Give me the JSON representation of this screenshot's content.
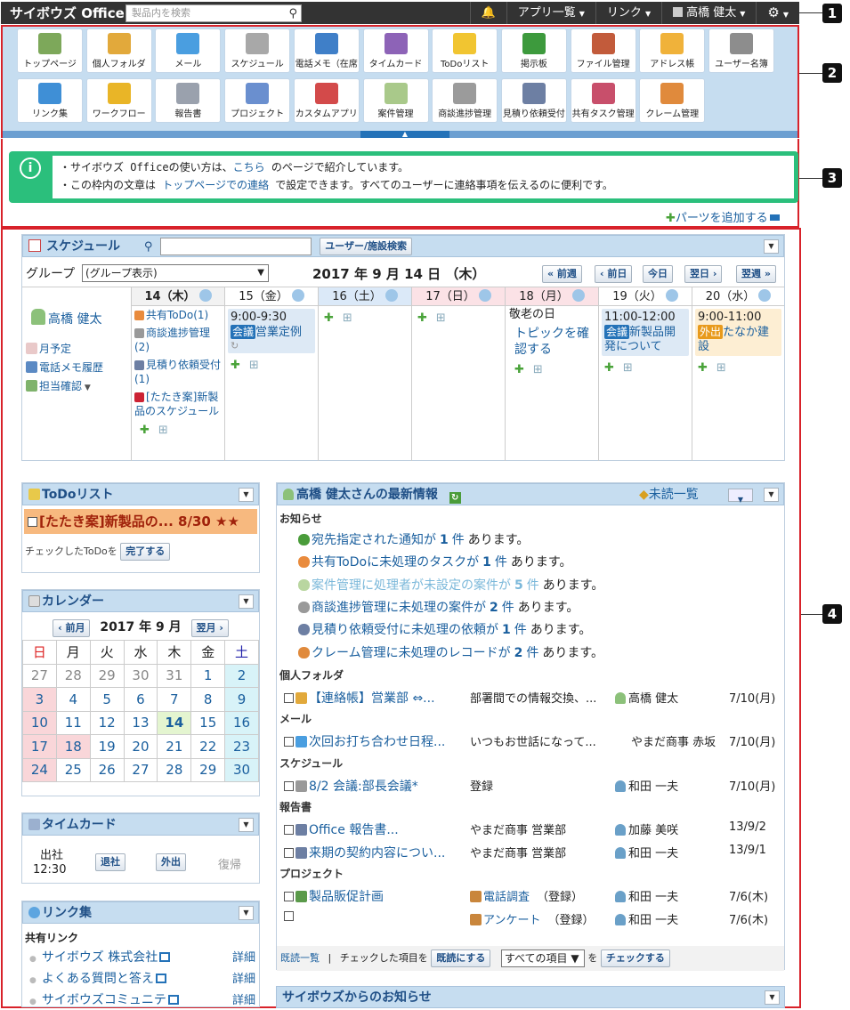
{
  "topbar": {
    "logo": "サイボウズ Office",
    "search_placeholder": "製品内を検索",
    "bell": "🔔",
    "apps_menu": "アプリ一覧",
    "link_menu": "リンク",
    "user_name": "高橋 健太",
    "gear": "⚙"
  },
  "markers": [
    "1",
    "2",
    "3",
    "4"
  ],
  "apps": [
    {
      "label": "トップページ",
      "color": "#7da85a"
    },
    {
      "label": "個人フォルダ",
      "color": "#e2a93b"
    },
    {
      "label": "メール",
      "color": "#4a9ee0"
    },
    {
      "label": "スケジュール",
      "color": "#a8a8a8"
    },
    {
      "label": "電話メモ（在席",
      "color": "#3f7fc8"
    },
    {
      "label": "タイムカード",
      "color": "#8d63b7"
    },
    {
      "label": "ToDoリスト",
      "color": "#f1c531"
    },
    {
      "label": "掲示板",
      "color": "#3d9a3d"
    },
    {
      "label": "ファイル管理",
      "color": "#c25b3b"
    },
    {
      "label": "アドレス帳",
      "color": "#f0b23a"
    },
    {
      "label": "ユーザー名簿",
      "color": "#8d8d8d"
    },
    {
      "label": "リンク集",
      "color": "#3f8fd6"
    },
    {
      "label": "ワークフロー",
      "color": "#e9b527"
    },
    {
      "label": "報告書",
      "color": "#9aa1ad"
    },
    {
      "label": "プロジェクト",
      "color": "#6a8fcf"
    },
    {
      "label": "カスタムアプリ",
      "color": "#d34a4a"
    },
    {
      "label": "案件管理",
      "color": "#a9c98a"
    },
    {
      "label": "商談進捗管理",
      "color": "#9b9b9b"
    },
    {
      "label": "見積り依頼受付",
      "color": "#6d7fa3"
    },
    {
      "label": "共有タスク管理",
      "color": "#c84f6b"
    },
    {
      "label": "クレーム管理",
      "color": "#e08a3c"
    }
  ],
  "info": {
    "line1a": "・サイボウズ Officeの使い方は、",
    "line1link": "こちら",
    "line1b": " のページで紹介しています。",
    "line2a": "・この枠内の文章は ",
    "line2link": "トップページでの連絡",
    "line2b": " で設定できます。すべてのユーザーに連絡事項を伝えるのに便利です。",
    "add_parts": "パーツを追加する"
  },
  "schedule": {
    "title": "スケジュール",
    "search_button": "ユーザー/施設検索",
    "group_label": "グループ",
    "group_select": "(グループ表示)",
    "date_title": "2017 年 9 月 14 日 （木）",
    "nav": [
      "« 前週",
      "‹ 前日",
      "今日",
      "翌日 ›",
      "翌週 »"
    ],
    "days": [
      {
        "label": "14（木）",
        "bg": "#f2f2f2"
      },
      {
        "label": "15（金）",
        "bg": "#ffffff"
      },
      {
        "label": "16（土）",
        "bg": "#dbe9f8"
      },
      {
        "label": "17（日）",
        "bg": "#fbe2e6"
      },
      {
        "label": "18（月）",
        "bg": "#fbe2e6"
      },
      {
        "label": "19（火）",
        "bg": "#ffffff"
      },
      {
        "label": "20（水）",
        "bg": "#ffffff"
      }
    ],
    "user": "高橋 健太",
    "user_links": [
      "月予定",
      "電話メモ履歴",
      "担当確認"
    ],
    "day14": [
      "共有ToDo(1)",
      "商談進捗管理(2)",
      "見積り依頼受付(1)",
      "[たたき案]新製品のスケジュール"
    ],
    "day15": {
      "time": "9:00-9:30",
      "badge": "会議",
      "title": "営業定例"
    },
    "day18": {
      "holiday": "敬老の日",
      "item": "トピックを確認する"
    },
    "day19": {
      "time": "11:00-12:00",
      "badge": "会議",
      "title": "新製品開発について"
    },
    "day20": {
      "time": "9:00-11:00",
      "badge": "外出",
      "title": "たなか建設"
    }
  },
  "todo": {
    "title": "ToDoリスト",
    "item": "[たたき案]新製品の... 8/30 ★★",
    "footer_label": "チェックしたToDoを",
    "complete_button": "完了する"
  },
  "calendar": {
    "title": "カレンダー",
    "prev": "‹ 前月",
    "month": "2017 年 9 月",
    "next": "翌月 ›",
    "weekdays": [
      "日",
      "月",
      "火",
      "水",
      "木",
      "金",
      "土"
    ],
    "weeks": [
      [
        "27",
        "28",
        "29",
        "30",
        "31",
        "1",
        "2"
      ],
      [
        "3",
        "4",
        "5",
        "6",
        "7",
        "8",
        "9"
      ],
      [
        "10",
        "11",
        "12",
        "13",
        "14",
        "15",
        "16"
      ],
      [
        "17",
        "18",
        "19",
        "20",
        "21",
        "22",
        "23"
      ],
      [
        "24",
        "25",
        "26",
        "27",
        "28",
        "29",
        "30"
      ]
    ]
  },
  "timecard": {
    "title": "タイムカード",
    "in_label": "出社",
    "in_time": "12:30",
    "leave": "退社",
    "out": "外出",
    "return": "復帰"
  },
  "links": {
    "title": "リンク集",
    "section": "共有リンク",
    "items": [
      "サイボウズ 株式会社",
      "よくある質問と答え",
      "サイボウズコミュニテ"
    ],
    "detail": "詳細"
  },
  "news": {
    "title": "高橋 健太さんの最新情報",
    "unread": "未読一覧",
    "notice": "お知らせ",
    "notices": [
      {
        "text": "宛先指定された通知が",
        "count": "1",
        "unit": "件",
        "tail": "あります。",
        "muted": false
      },
      {
        "text": "共有ToDoに未処理のタスクが",
        "count": "1",
        "unit": "件",
        "tail": "あります。",
        "muted": false
      },
      {
        "text": "案件管理に処理者が未設定の案件が",
        "count": "5",
        "unit": "件",
        "tail": "あります。",
        "muted": true
      },
      {
        "text": "商談進捗管理に未処理の案件が",
        "count": "2",
        "unit": "件",
        "tail": "あります。",
        "muted": false
      },
      {
        "text": "見積り依頼受付に未処理の依頼が",
        "count": "1",
        "unit": "件",
        "tail": "あります。",
        "muted": false
      },
      {
        "text": "クレーム管理に未処理のレコードが",
        "count": "2",
        "unit": "件",
        "tail": "あります。",
        "muted": false
      }
    ],
    "sections": [
      {
        "name": "個人フォルダ",
        "rows": [
          {
            "title": "【連絡帳】営業部 ⇔...",
            "desc": "部署間での情報交換、...",
            "who": "高橋 健太",
            "date": "7/10(月)"
          }
        ]
      },
      {
        "name": "メール",
        "rows": [
          {
            "title": "次回お打ち合わせ日程...",
            "desc": "いつもお世話になって...",
            "who": "やまだ商事 赤坂",
            "date": "7/10(月)"
          }
        ]
      },
      {
        "name": "スケジュール",
        "rows": [
          {
            "title": "8/2 会議:部長会議*",
            "desc": "登録",
            "who": "和田 一夫",
            "date": "7/10(月)"
          }
        ]
      },
      {
        "name": "報告書",
        "rows": [
          {
            "title": "Office 報告書...",
            "desc": "やまだ商事 営業部",
            "who": "加藤 美咲",
            "date": "13/9/2"
          },
          {
            "title": "来期の契約内容につい...",
            "desc": "やまだ商事 営業部",
            "who": "和田 一夫",
            "date": "13/9/1"
          }
        ]
      },
      {
        "name": "プロジェクト",
        "rows": [
          {
            "title": "製品販促計画",
            "desc": "電話調査",
            "desc2": "（登録）",
            "who": "和田 一夫",
            "date": "7/6(木)"
          },
          {
            "title": "",
            "desc": "アンケート",
            "desc2": "（登録）",
            "who": "和田 一夫",
            "date": "7/6(木)"
          }
        ]
      }
    ],
    "footer_unread": "既読一覧",
    "footer_label": "チェックした項目を",
    "mark_read": "既読にする",
    "select": "すべての項目",
    "wo": "を",
    "check": "チェックする"
  },
  "cybozu_news": {
    "title": "サイボウズからのお知らせ"
  }
}
